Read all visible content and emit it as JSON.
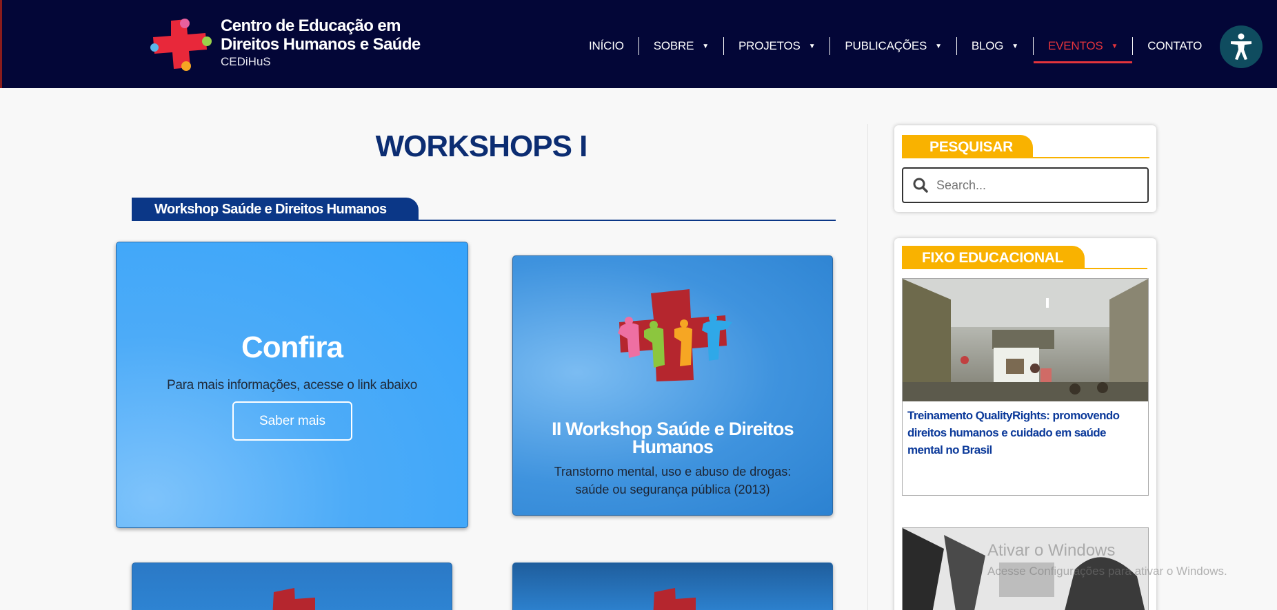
{
  "brand": {
    "line1": "Centro de Educação em",
    "line2": "Direitos Humanos e Saúde",
    "short": "CEDiHuS"
  },
  "nav": {
    "items": [
      {
        "label": "INÍCIO"
      },
      {
        "label": "SOBRE"
      },
      {
        "label": "PROJETOS"
      },
      {
        "label": "PUBLICAÇÕES"
      },
      {
        "label": "BLOG"
      },
      {
        "label": "EVENTOS"
      },
      {
        "label": "CONTATO"
      }
    ],
    "active": "EVENTOS",
    "active_color": "#e4343c"
  },
  "main": {
    "title": "WORKSHOPS I",
    "section_tab": "Workshop Saúde e Direitos Humanos",
    "card_confira": {
      "title": "Confira",
      "text": "Para mais informações, acesse o link abaixo",
      "button": "Saber mais"
    },
    "card_workshop": {
      "title": "II Workshop Saúde e Direitos Humanos",
      "subtitle_line1": "Transtorno mental, uso e abuso de drogas:",
      "subtitle_line2": "saúde ou segurança pública (2013)"
    }
  },
  "sidebar": {
    "search_tab": "PESQUISAR",
    "search_placeholder": "Search...",
    "fixo_tab": "FIXO EDUCACIONAL",
    "post_title": "Treinamento QualityRights: promovendo direitos humanos e cuidado em saúde mental no Brasil"
  },
  "watermark": {
    "line1": "Ativar o Windows",
    "line2": "Acesse Configurações para ativar o Windows."
  },
  "colors": {
    "header_bg": "#030637",
    "title_blue": "#0c2d72",
    "section_blue": "#0b3787",
    "sidebar_yellow": "#f9b200",
    "accessibility_teal": "#0f4c5f"
  },
  "icons": [
    "cedihus-logo-icon",
    "chevron-down-icon",
    "accessibility-icon",
    "search-icon",
    "workshop-logo-icon"
  ]
}
